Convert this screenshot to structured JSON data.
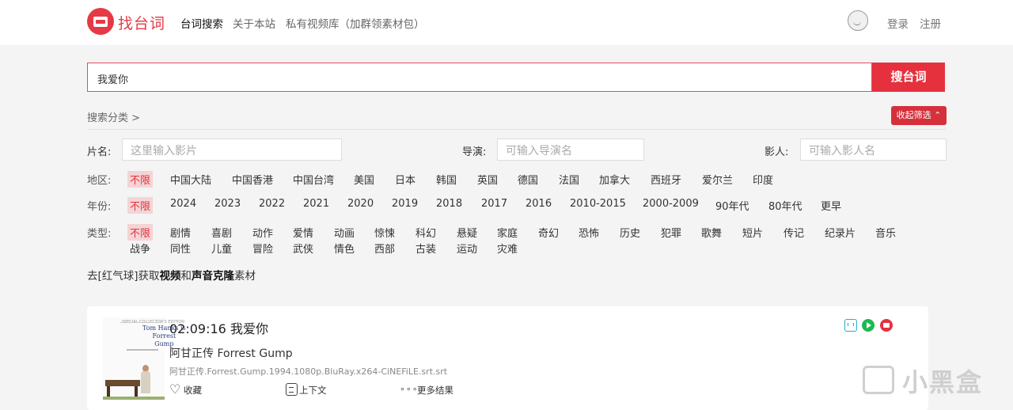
{
  "header": {
    "logo_text": "找台词",
    "nav": [
      "台词搜索",
      "关于本站",
      "私有视频库（加群领素材包）"
    ],
    "login": "登录",
    "register": "注册"
  },
  "search": {
    "value": "我爱你",
    "button": "搜台词"
  },
  "filters": {
    "category_label": "搜索分类 >",
    "collapse_label": "收起筛选 ⌃",
    "title_label": "片名:",
    "title_placeholder": "这里输入影片",
    "director_label": "导演:",
    "director_placeholder": "可输入导演名",
    "actor_label": "影人:",
    "actor_placeholder": "可输入影人名",
    "region_label": "地区:",
    "regions": [
      "不限",
      "中国大陆",
      "中国香港",
      "中国台湾",
      "美国",
      "日本",
      "韩国",
      "英国",
      "德国",
      "法国",
      "加拿大",
      "西班牙",
      "爱尔兰",
      "印度"
    ],
    "year_label": "年份:",
    "years": [
      "不限",
      "2024",
      "2023",
      "2022",
      "2021",
      "2020",
      "2019",
      "2018",
      "2017",
      "2016",
      "2010-2015",
      "2000-2009",
      "90年代",
      "80年代",
      "更早"
    ],
    "genre_label": "类型:",
    "genres_row1": [
      "不限",
      "剧情",
      "喜剧",
      "动作",
      "爱情",
      "动画",
      "惊悚",
      "科幻",
      "悬疑",
      "家庭",
      "奇幻",
      "恐怖",
      "历史",
      "犯罪",
      "歌舞",
      "短片",
      "传记",
      "纪录片",
      "音乐"
    ],
    "genres_row2": [
      "战争",
      "同性",
      "儿童",
      "冒险",
      "武侠",
      "情色",
      "西部",
      "古装",
      "运动",
      "灾难"
    ]
  },
  "promo": {
    "prefix": "去[红气球]获取",
    "bold1": "视频",
    "mid": "和",
    "bold2": "声音克隆",
    "suffix": "素材"
  },
  "result": {
    "time_title": "02:09:16 我爱你",
    "movie_cn": "阿甘正传 Forrest Gump",
    "file": "阿甘正传.Forrest.Gump.1994.1080p.BluRay.x264-CiNEFiLE.srt.srt",
    "favorite": "收藏",
    "context": "上下文",
    "more": "更多结果",
    "poster_text1": "SPECIAL COLLECTOR'S EDITION",
    "poster_text2": "Tom Hanks is\nForrest\nGump",
    "icons": [
      "tv-icon",
      "play-icon",
      "film-icon"
    ]
  },
  "watermark": "小黑盒"
}
